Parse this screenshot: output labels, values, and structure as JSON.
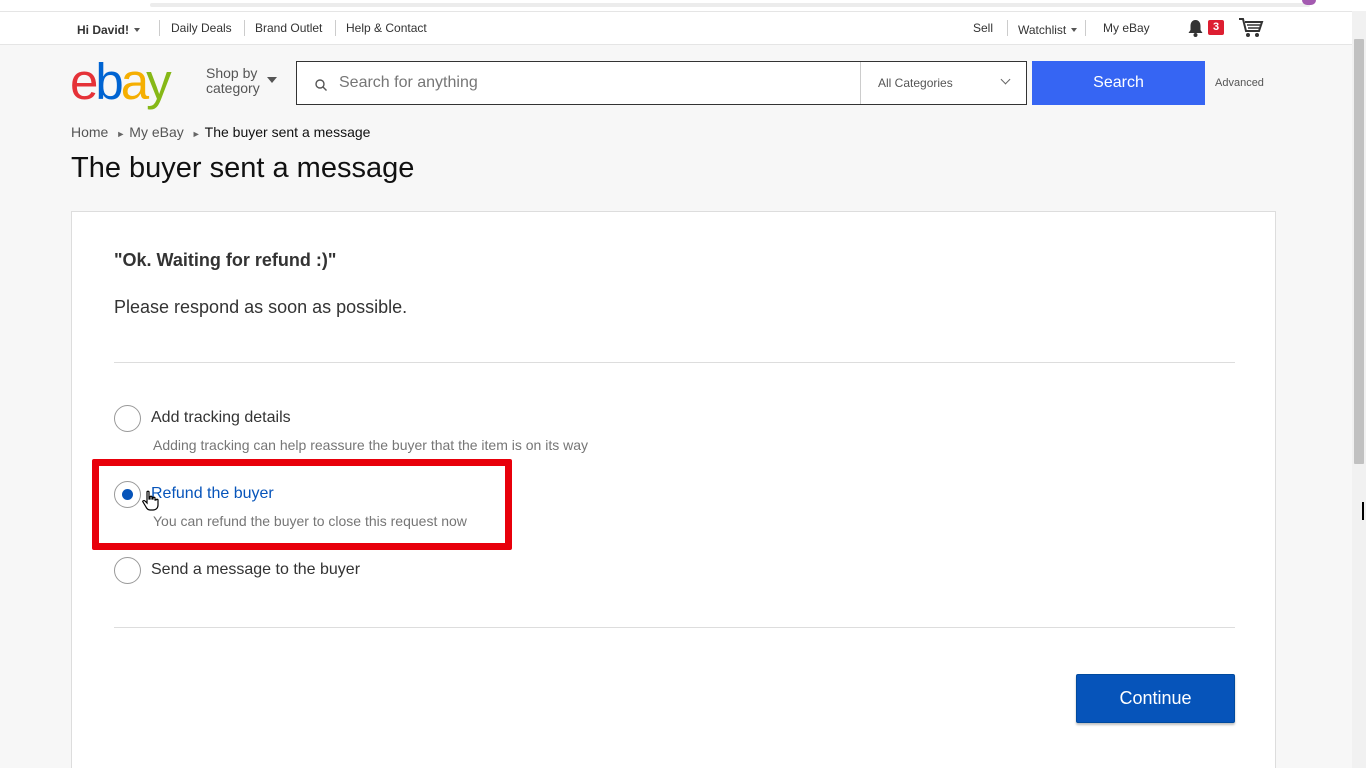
{
  "topbar": {
    "greeting": "Hi David!",
    "daily_deals": "Daily Deals",
    "brand_outlet": "Brand Outlet",
    "help_contact": "Help & Contact",
    "sell": "Sell",
    "watchlist": "Watchlist",
    "my_ebay": "My eBay",
    "notification_count": "3"
  },
  "header": {
    "logo": {
      "e": "e",
      "b": "b",
      "a": "a",
      "y": "y"
    },
    "shop_by_line1": "Shop by",
    "shop_by_line2": "category",
    "search_placeholder": "Search for anything",
    "category_selected": "All Categories",
    "search_button": "Search",
    "advanced_link": "Advanced"
  },
  "breadcrumb": {
    "home": "Home",
    "my_ebay": "My eBay",
    "current": "The buyer sent a message",
    "separator": "►"
  },
  "page": {
    "title": "The buyer sent a message",
    "quote": "\"Ok. Waiting for refund :)\"",
    "respond_text": "Please respond as soon as possible."
  },
  "options": [
    {
      "label": "Add tracking details",
      "description": "Adding tracking can help reassure the buyer that the item is on its way",
      "checked": false
    },
    {
      "label": "Refund the buyer",
      "description": "You can refund the buyer to close this request now",
      "checked": true
    },
    {
      "label": "Send a message to the buyer",
      "description": "",
      "checked": false
    }
  ],
  "actions": {
    "continue_button": "Continue"
  },
  "colors": {
    "accent_blue": "#0654ba",
    "search_blue": "#3665f3",
    "highlight_red": "#e8000b",
    "badge_red": "#dd1e31"
  }
}
